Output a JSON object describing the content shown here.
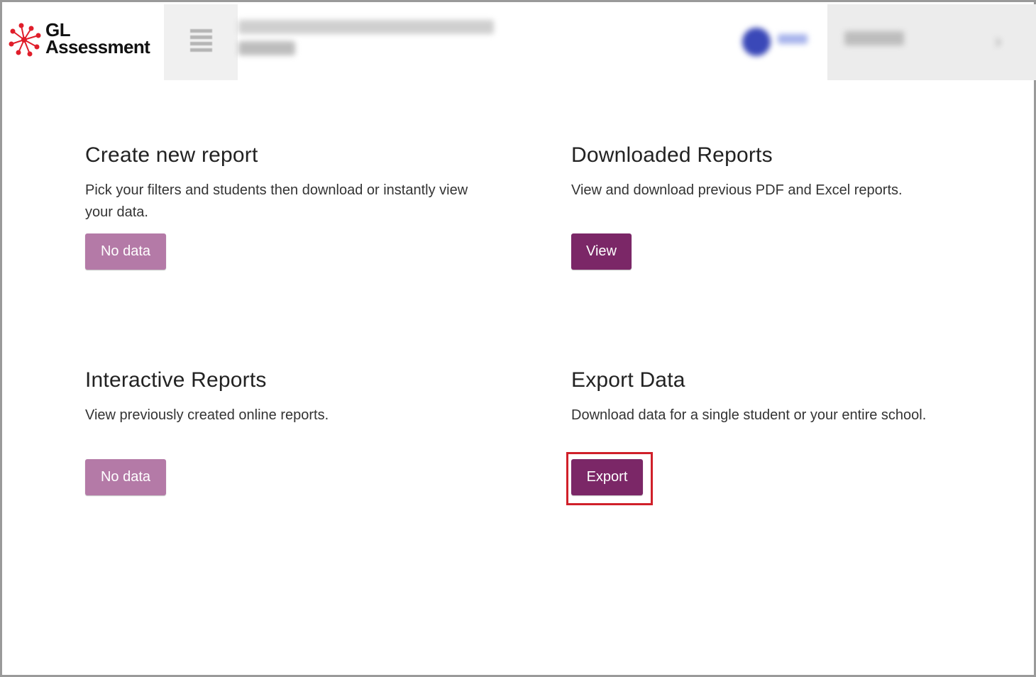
{
  "header": {
    "logo_line1": "GL",
    "logo_line2": "Assessment",
    "accent_color": "#e01e2b"
  },
  "cards": {
    "create": {
      "title": "Create new report",
      "description": "Pick your filters and students then download or instantly view your data.",
      "button": "No data"
    },
    "downloaded": {
      "title": "Downloaded Reports",
      "description": "View and download previous PDF and Excel reports.",
      "button": "View"
    },
    "interactive": {
      "title": "Interactive Reports",
      "description": "View previously created online reports.",
      "button": "No data"
    },
    "export": {
      "title": "Export Data",
      "description": "Download data for a single student or your entire school.",
      "button": "Export"
    }
  },
  "colors": {
    "primary_button": "#7b2767",
    "disabled_button": "#b47aa7",
    "highlight_border": "#d0202a"
  }
}
